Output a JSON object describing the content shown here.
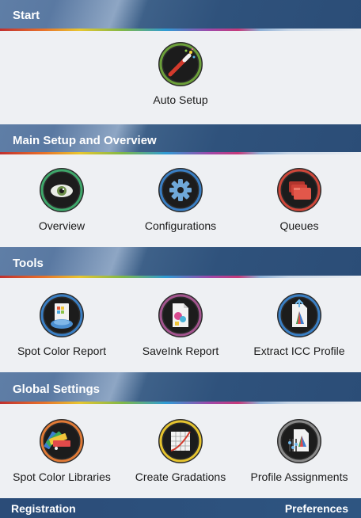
{
  "sections": [
    {
      "title": "Start",
      "items": [
        {
          "label": "Auto Setup",
          "icon": "magic-wand-icon"
        }
      ]
    },
    {
      "title": "Main Setup and Overview",
      "items": [
        {
          "label": "Overview",
          "icon": "eye-icon"
        },
        {
          "label": "Configurations",
          "icon": "gear-icon"
        },
        {
          "label": "Queues",
          "icon": "folders-icon"
        }
      ]
    },
    {
      "title": "Tools",
      "items": [
        {
          "label": "Spot Color Report",
          "icon": "spot-color-report-icon"
        },
        {
          "label": "SaveInk Report",
          "icon": "saveink-report-icon"
        },
        {
          "label": "Extract ICC Profile",
          "icon": "extract-icc-profile-icon"
        }
      ]
    },
    {
      "title": "Global Settings",
      "items": [
        {
          "label": "Spot Color Libraries",
          "icon": "color-swatch-icon"
        },
        {
          "label": "Create Gradations",
          "icon": "gradation-grid-icon"
        },
        {
          "label": "Profile Assignments",
          "icon": "profile-assignments-icon"
        }
      ]
    }
  ],
  "footer": {
    "left": "Registration",
    "right": "Preferences"
  },
  "colors": {
    "header_dark": "#2b4d77",
    "header_light": "#8ea6c4",
    "body_bg": "#eef0f3",
    "ring_green": "#3fa86b",
    "ring_blue": "#3a7fc4",
    "ring_red": "#d0473a",
    "ring_purple": "#a4558f",
    "ring_orange": "#e07a36",
    "ring_yellow": "#e6c42f"
  }
}
